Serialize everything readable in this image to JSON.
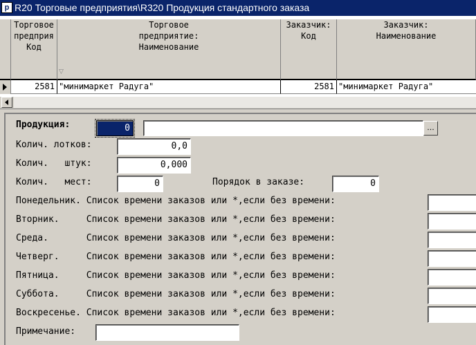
{
  "window": {
    "title": "R20 Торговые предприятия\\R320 Продукция стандартного заказа",
    "icon_name": "app-icon",
    "icon_glyph": "p"
  },
  "grid": {
    "columns": [
      {
        "header": "Торговое\nпредприя\nКод"
      },
      {
        "header": "Торговое\nпредприятие:\nНаименование"
      },
      {
        "header": "Заказчик:\nКод"
      },
      {
        "header": "Заказчик:\nНаименование"
      }
    ],
    "rows": [
      {
        "cells": [
          "2581",
          "\"минимаркет Радуга\"",
          "2581",
          "\"минимаркет Радуга\""
        ]
      }
    ]
  },
  "form": {
    "product": {
      "label": "Продукция:",
      "code": "0",
      "name": ""
    },
    "trays": {
      "label": "Колич. лотков:",
      "value": "0,0"
    },
    "pieces": {
      "label": "Колич.   штук:",
      "value": "0,000"
    },
    "places": {
      "label": "Колич.   мест:",
      "value": "0"
    },
    "order": {
      "label": "Порядок в заказе:",
      "value": "0"
    },
    "days": [
      {
        "label": "Понедельник. Список времени заказов или *,если без времени:",
        "value": ""
      },
      {
        "label": "Вторник.     Список времени заказов или *,если без времени:",
        "value": ""
      },
      {
        "label": "Среда.       Список времени заказов или *,если без времени:",
        "value": ""
      },
      {
        "label": "Четверг.     Список времени заказов или *,если без времени:",
        "value": ""
      },
      {
        "label": "Пятница.     Список времени заказов или *,если без времени:",
        "value": ""
      },
      {
        "label": "Суббота.     Список времени заказов или *,если без времени:",
        "value": ""
      },
      {
        "label": "Воскресенье. Список времени заказов или *,если без времени:",
        "value": ""
      }
    ],
    "note": {
      "label": "Примечание:",
      "value": ""
    },
    "ellipsis_label": "..."
  }
}
